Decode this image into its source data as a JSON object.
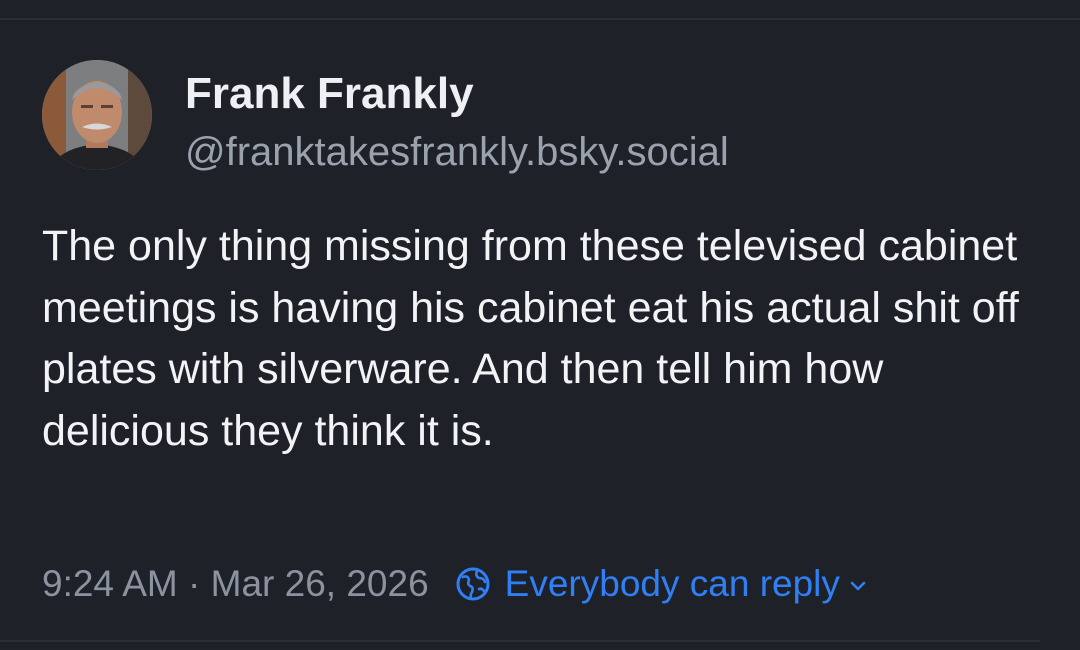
{
  "post": {
    "author": {
      "display_name": "Frank Frankly",
      "handle": "@franktakesfrankly.bsky.social",
      "avatar_icon": "person-photo-avatar"
    },
    "text": "The only thing missing from these televised cabinet meetings is having his cabinet eat his actual shit off plates with silverware. And then tell him how delicious they think it is.",
    "timestamp": "9:24 AM · Mar 26, 2026",
    "reply_setting": {
      "label": "Everybody can reply",
      "icon": "globe-icon",
      "dropdown_icon": "chevron-down-icon"
    }
  },
  "colors": {
    "background": "#1f2129",
    "primary_text": "#f1f3f5",
    "secondary_text": "#9aa2ae",
    "accent": "#2f7ff5"
  }
}
